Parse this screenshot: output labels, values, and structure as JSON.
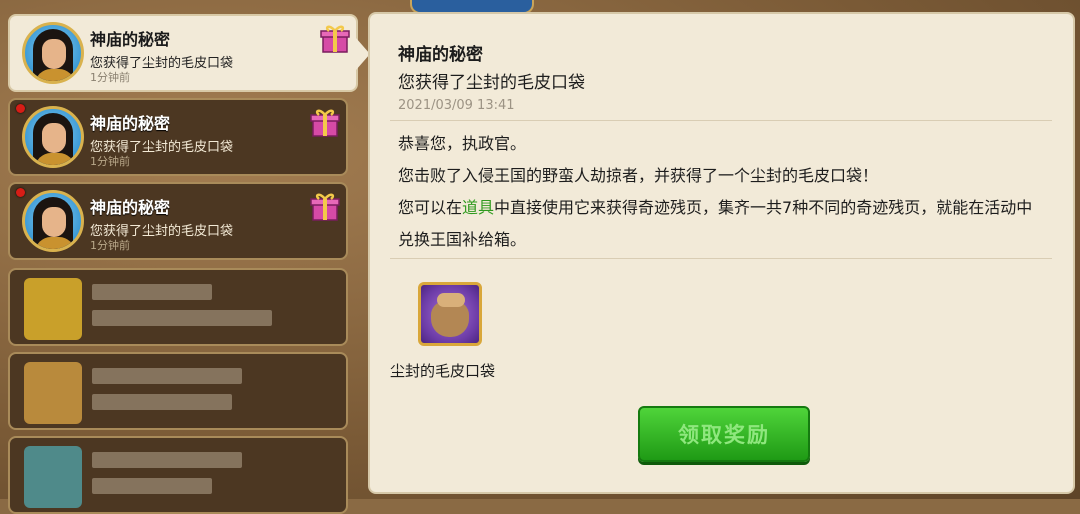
{
  "mails": [
    {
      "title": "神庙的秘密",
      "subtitle": "您获得了尘封的毛皮口袋",
      "time": "1分钟前",
      "unread": false,
      "selected": true
    },
    {
      "title": "神庙的秘密",
      "subtitle": "您获得了尘封的毛皮口袋",
      "time": "1分钟前",
      "unread": true,
      "selected": false
    },
    {
      "title": "神庙的秘密",
      "subtitle": "您获得了尘封的毛皮口袋",
      "time": "1分钟前",
      "unread": true,
      "selected": false
    }
  ],
  "detail": {
    "title": "神庙的秘密",
    "subtitle": "您获得了尘封的毛皮口袋",
    "date": "2021/03/09 13:41",
    "line1": "恭喜您，执政官。",
    "line2": "您击败了入侵王国的野蛮人劫掠者，并获得了一个尘封的毛皮口袋！",
    "line3_pre": "您可以在",
    "line3_link": "道具",
    "line3_post": "中直接使用它来获得奇迹残页，集齐一共7种不同的奇迹残页，就能在活动中兑换王国补给箱。",
    "item_name": "尘封的毛皮口袋",
    "claim_label": "领取奖励"
  },
  "colors": {
    "unread_dot": "#d71d16",
    "link": "#2f9a1e",
    "claim_button": "#36b826"
  }
}
